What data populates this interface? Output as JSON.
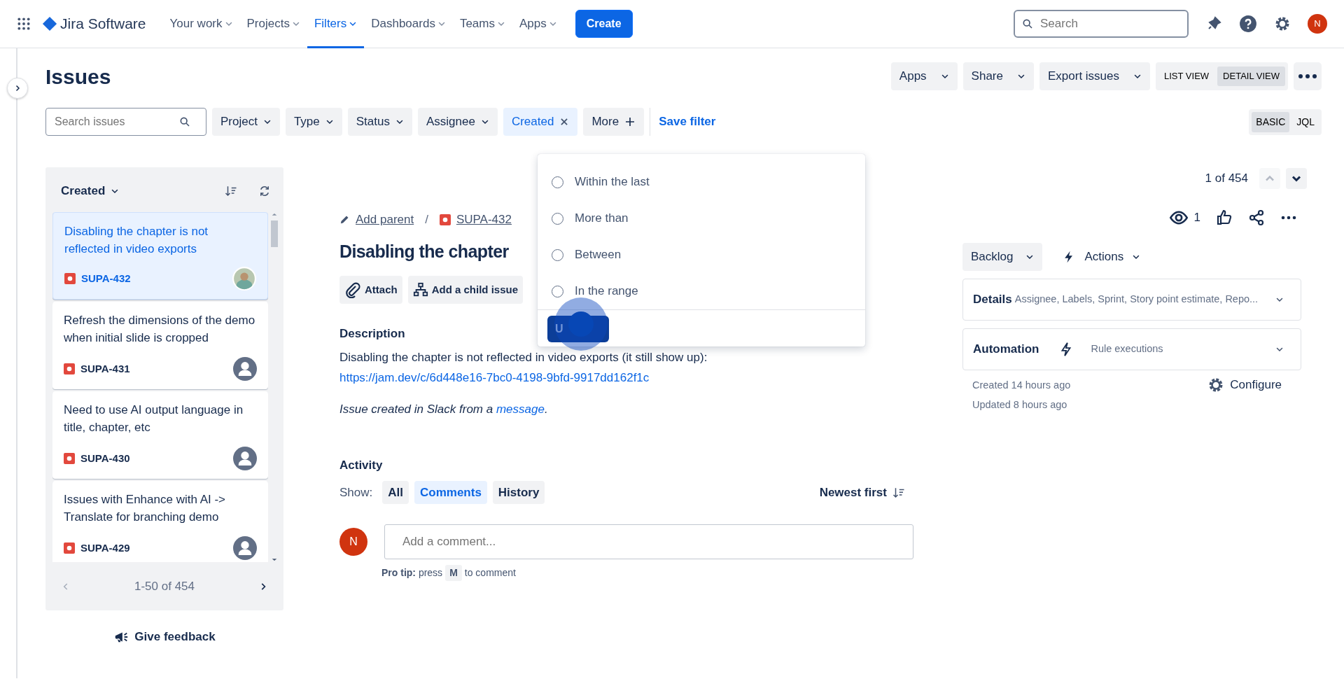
{
  "nav": {
    "brand": "Jira Software",
    "items": [
      {
        "label": "Your work",
        "selected": false
      },
      {
        "label": "Projects",
        "selected": false
      },
      {
        "label": "Filters",
        "selected": true
      },
      {
        "label": "Dashboards",
        "selected": false
      },
      {
        "label": "Teams",
        "selected": false
      },
      {
        "label": "Apps",
        "selected": false
      }
    ],
    "create": "Create",
    "search": {
      "placeholder": "Search"
    },
    "user_initial": "N"
  },
  "page_title": "Issues",
  "header_buttons": [
    "Apps",
    "Share",
    "Export issues"
  ],
  "view_toggle": [
    {
      "label": "LIST VIEW",
      "selected": false
    },
    {
      "label": "DETAIL VIEW",
      "selected": true
    }
  ],
  "filters": {
    "search": {
      "placeholder": "Search issues"
    },
    "chips": [
      {
        "label": "Project",
        "kind": "dropdown"
      },
      {
        "label": "Type",
        "kind": "dropdown"
      },
      {
        "label": "Status",
        "kind": "dropdown"
      },
      {
        "label": "Assignee",
        "kind": "dropdown"
      },
      {
        "label": "Created",
        "kind": "active"
      },
      {
        "label": "More",
        "kind": "more"
      }
    ],
    "save": "Save filter",
    "mode": [
      {
        "label": "BASIC",
        "selected": true
      },
      {
        "label": "JQL",
        "selected": false
      }
    ]
  },
  "list": {
    "sort": "Created",
    "issues": [
      {
        "title": "Disabling the chapter is not reflected in video exports",
        "key": "SUPA-432",
        "selected": true,
        "kind": "photo"
      },
      {
        "title": "Refresh the dimensions of the demo when initial slide is cropped",
        "key": "SUPA-431",
        "selected": false,
        "kind": "default"
      },
      {
        "title": "Need to use AI output language in title, chapter, etc",
        "key": "SUPA-430",
        "selected": false,
        "kind": "default"
      },
      {
        "title": "Issues with Enhance with AI -> Translate for branching demo",
        "key": "SUPA-429",
        "selected": false,
        "kind": "default"
      }
    ],
    "pagination": "1-50 of 454"
  },
  "feedback": "Give feedback",
  "dropdown": {
    "options": [
      {
        "label": "Within the last",
        "selected": false
      },
      {
        "label": "More than",
        "selected": false
      },
      {
        "label": "Between",
        "selected": false
      },
      {
        "label": "In the range",
        "selected": false
      }
    ],
    "button": "U"
  },
  "detail": {
    "counter": "1 of 454",
    "parent": "Add parent",
    "separator": "/",
    "key": "SUPA-432",
    "title": "Disabling the chapter",
    "actions": [
      "Attach",
      "Add a child issue"
    ],
    "description_heading": "Description",
    "description": {
      "text": "Disabling the chapter is not reflected in video exports (it still show up): ",
      "link": "https://jam.dev/c/6d448e16-7bc0-4198-9bfd-9917dd162f1c"
    },
    "note": {
      "text": "Issue created in Slack from a ",
      "link": "message",
      "after": "."
    },
    "activity": {
      "heading": "Activity",
      "show": "Show:",
      "filters": [
        {
          "label": "All",
          "selected": false
        },
        {
          "label": "Comments",
          "selected": true
        },
        {
          "label": "History",
          "selected": false
        }
      ],
      "sort": "Newest first",
      "comment": {
        "placeholder": "Add a comment..."
      },
      "user_initial": "N",
      "tip": {
        "before": "**Pro tip:** press",
        "key": "M",
        "after": "to comment"
      }
    },
    "watchers": "1",
    "status": "Backlog",
    "actions_button": "Actions",
    "panels": [
      {
        "kind": "details",
        "title": "Details",
        "summary": "Assignee, Labels, Sprint, Story point estimate, Repo..."
      },
      {
        "kind": "automation",
        "title": "Automation",
        "summary": "Rule executions"
      }
    ],
    "created": "Created 14 hours ago",
    "updated": "Updated 8 hours ago",
    "configure": "Configure"
  }
}
